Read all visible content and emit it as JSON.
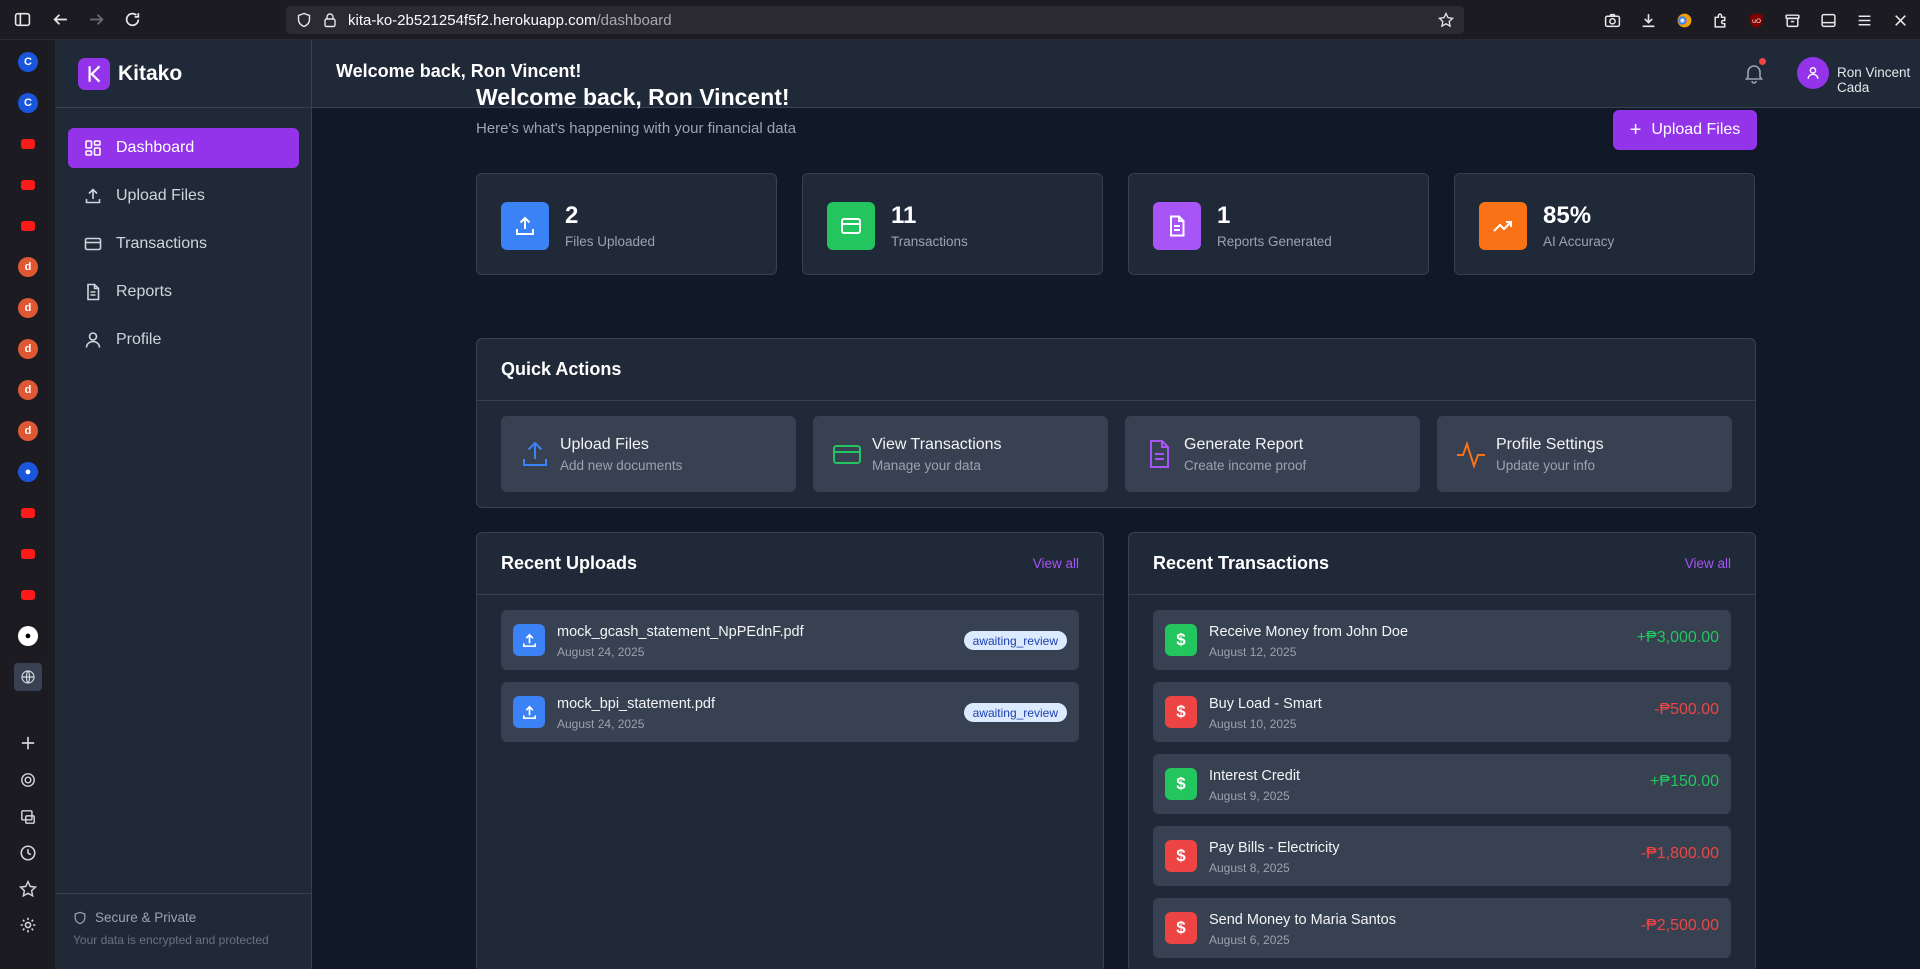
{
  "browser": {
    "url_host": "kita-ko-2b521254f5f2.herokuapp.com",
    "url_path": "/dashboard"
  },
  "app": {
    "brand": "Kitako",
    "header_title": "Welcome back, Ron Vincent!",
    "user_name": "Ron Vincent Cada"
  },
  "sidebar": {
    "items": [
      {
        "label": "Dashboard",
        "icon": "grid-icon"
      },
      {
        "label": "Upload Files",
        "icon": "upload-icon"
      },
      {
        "label": "Transactions",
        "icon": "credit-card-icon"
      },
      {
        "label": "Reports",
        "icon": "document-icon"
      },
      {
        "label": "Profile",
        "icon": "user-icon"
      }
    ],
    "security_title": "Secure & Private",
    "security_sub": "Your data is encrypted and protected"
  },
  "main": {
    "title": "Welcome back, Ron Vincent!",
    "subtitle": "Here's what's happening with your financial data",
    "upload_button": "Upload Files"
  },
  "stats": [
    {
      "value": "2",
      "label": "Files Uploaded",
      "color": "#2563eb"
    },
    {
      "value": "11",
      "label": "Transactions",
      "color": "#16a34a"
    },
    {
      "value": "1",
      "label": "Reports Generated",
      "color": "#9333ea"
    },
    {
      "value": "85%",
      "label": "AI Accuracy",
      "color": "#ea580c"
    }
  ],
  "quick_actions": {
    "title": "Quick Actions",
    "items": [
      {
        "title": "Upload Files",
        "sub": "Add new documents",
        "color": "#3b82f6"
      },
      {
        "title": "View Transactions",
        "sub": "Manage your data",
        "color": "#22c55e"
      },
      {
        "title": "Generate Report",
        "sub": "Create income proof",
        "color": "#a855f7"
      },
      {
        "title": "Profile Settings",
        "sub": "Update your info",
        "color": "#f97316"
      }
    ]
  },
  "recent_uploads": {
    "title": "Recent Uploads",
    "view_all": "View all",
    "items": [
      {
        "name": "mock_gcash_statement_NpPEdnF.pdf",
        "date": "August 24, 2025",
        "status": "awaiting_review"
      },
      {
        "name": "mock_bpi_statement.pdf",
        "date": "August 24, 2025",
        "status": "awaiting_review"
      }
    ]
  },
  "recent_transactions": {
    "title": "Recent Transactions",
    "view_all": "View all",
    "items": [
      {
        "name": "Receive Money from John Doe",
        "date": "August 12, 2025",
        "amount": "+₱3,000.00",
        "type": "credit"
      },
      {
        "name": "Buy Load - Smart",
        "date": "August 10, 2025",
        "amount": "-₱500.00",
        "type": "debit"
      },
      {
        "name": "Interest Credit",
        "date": "August 9, 2025",
        "amount": "+₱150.00",
        "type": "credit"
      },
      {
        "name": "Pay Bills - Electricity",
        "date": "August 8, 2025",
        "amount": "-₱1,800.00",
        "type": "debit"
      },
      {
        "name": "Send Money to Maria Santos",
        "date": "August 6, 2025",
        "amount": "-₱2,500.00",
        "type": "debit"
      }
    ]
  },
  "colors": {
    "accent": "#9333ea",
    "credit": "#22c55e",
    "debit": "#ef4444"
  }
}
